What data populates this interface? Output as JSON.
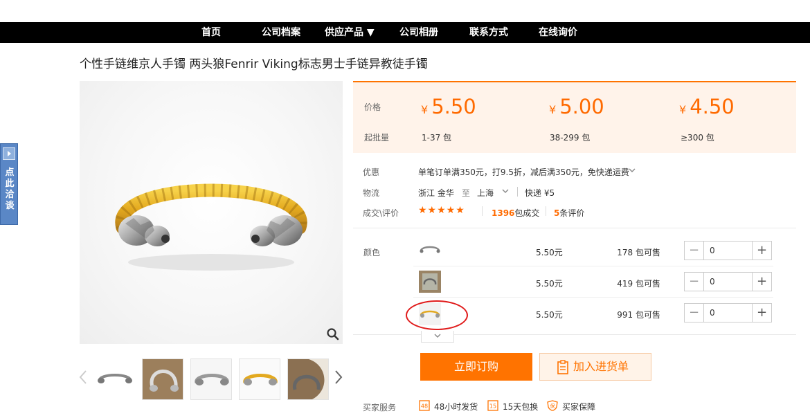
{
  "nav": {
    "items": [
      "首页",
      "公司档案",
      "供应产品 ▼",
      "公司相册",
      "联系方式",
      "在线询价"
    ]
  },
  "product": {
    "title": "个性手链维京人手镯 两头狼Fenrir Viking标志男士手链异教徒手镯"
  },
  "side_tab": {
    "label": "点此洽谈"
  },
  "pricing": {
    "price_label": "价格",
    "moq_label": "起批量",
    "currency": "¥",
    "tiers": [
      {
        "price": "5.50",
        "range": "1-37 包"
      },
      {
        "price": "5.00",
        "range": "38-299 包"
      },
      {
        "price": "4.50",
        "range": "≥300 包"
      }
    ]
  },
  "promo": {
    "label": "优惠",
    "text": "单笔订单满350元，打9.5折，减后满350元，免快递运费"
  },
  "shipping": {
    "label": "物流",
    "from": "浙江 金华",
    "to_word": "至",
    "to": "上海",
    "method": "快递 ¥5"
  },
  "deals": {
    "label": "成交\\评价",
    "stars": "★★★★★",
    "count": "1396",
    "count_unit": "包成交",
    "reviews": "5",
    "reviews_unit": "条评价"
  },
  "sku": {
    "label": "颜色",
    "rows": [
      {
        "price": "5.50元",
        "stock": "178 包可售",
        "qty": "0"
      },
      {
        "price": "5.50元",
        "stock": "419 包可售",
        "qty": "0"
      },
      {
        "price": "5.50元",
        "stock": "991 包可售",
        "qty": "0"
      }
    ]
  },
  "actions": {
    "buy": "立即订购",
    "cart": "加入进货单"
  },
  "services": {
    "label": "买家服务",
    "items": [
      {
        "icon": "48",
        "text": "48小时发货"
      },
      {
        "icon": "15",
        "text": "15天包换"
      },
      {
        "icon": "保",
        "text": "买家保障"
      }
    ]
  },
  "colors": {
    "accent": "#ff7300",
    "price": "#ff6a00",
    "nav_bg": "#000000",
    "highlight_circle": "#e01b1b",
    "side_tab": "#5a87c6",
    "gold": "#e3a91f"
  }
}
